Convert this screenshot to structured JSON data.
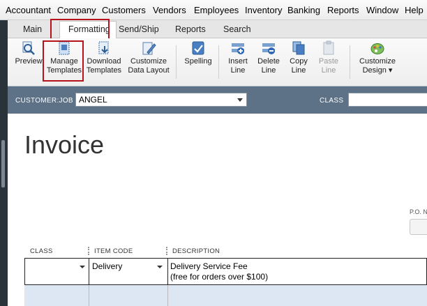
{
  "menu": [
    "Accountant",
    "Company",
    "Customers",
    "Vendors",
    "Employees",
    "Inventory",
    "Banking",
    "Reports",
    "Window",
    "Help"
  ],
  "tabs": [
    "Main",
    "Formatting",
    "Send/Ship",
    "Reports",
    "Search"
  ],
  "active_tab": "Formatting",
  "ribbon": [
    {
      "line1": "Preview",
      "line2": ""
    },
    {
      "line1": "Manage",
      "line2": "Templates"
    },
    {
      "line1": "Download",
      "line2": "Templates"
    },
    {
      "line1": "Customize",
      "line2": "Data Layout"
    },
    {
      "line1": "Spelling",
      "line2": ""
    },
    {
      "line1": "Insert",
      "line2": "Line"
    },
    {
      "line1": "Delete",
      "line2": "Line"
    },
    {
      "line1": "Copy",
      "line2": "Line"
    },
    {
      "line1": "Paste",
      "line2": "Line"
    },
    {
      "line1": "Customize",
      "line2": "Design ▾"
    }
  ],
  "customer_bar": {
    "customer_label": "CUSTOMER:JOB",
    "customer_value": "ANGEL",
    "class_label": "CLASS"
  },
  "invoice_title": "Invoice",
  "po_label": "P.O. N",
  "columns": [
    "CLASS",
    "ITEM CODE",
    "DESCRIPTION"
  ],
  "line_items": [
    {
      "class": "",
      "item_code": "Delivery",
      "description_line1": "Delivery Service Fee",
      "description_line2": "(free for orders over $100)"
    }
  ],
  "colors": {
    "highlight_box": "#b5121b",
    "customer_bar": "#5d7187",
    "empty_row": "#dde7f4"
  }
}
